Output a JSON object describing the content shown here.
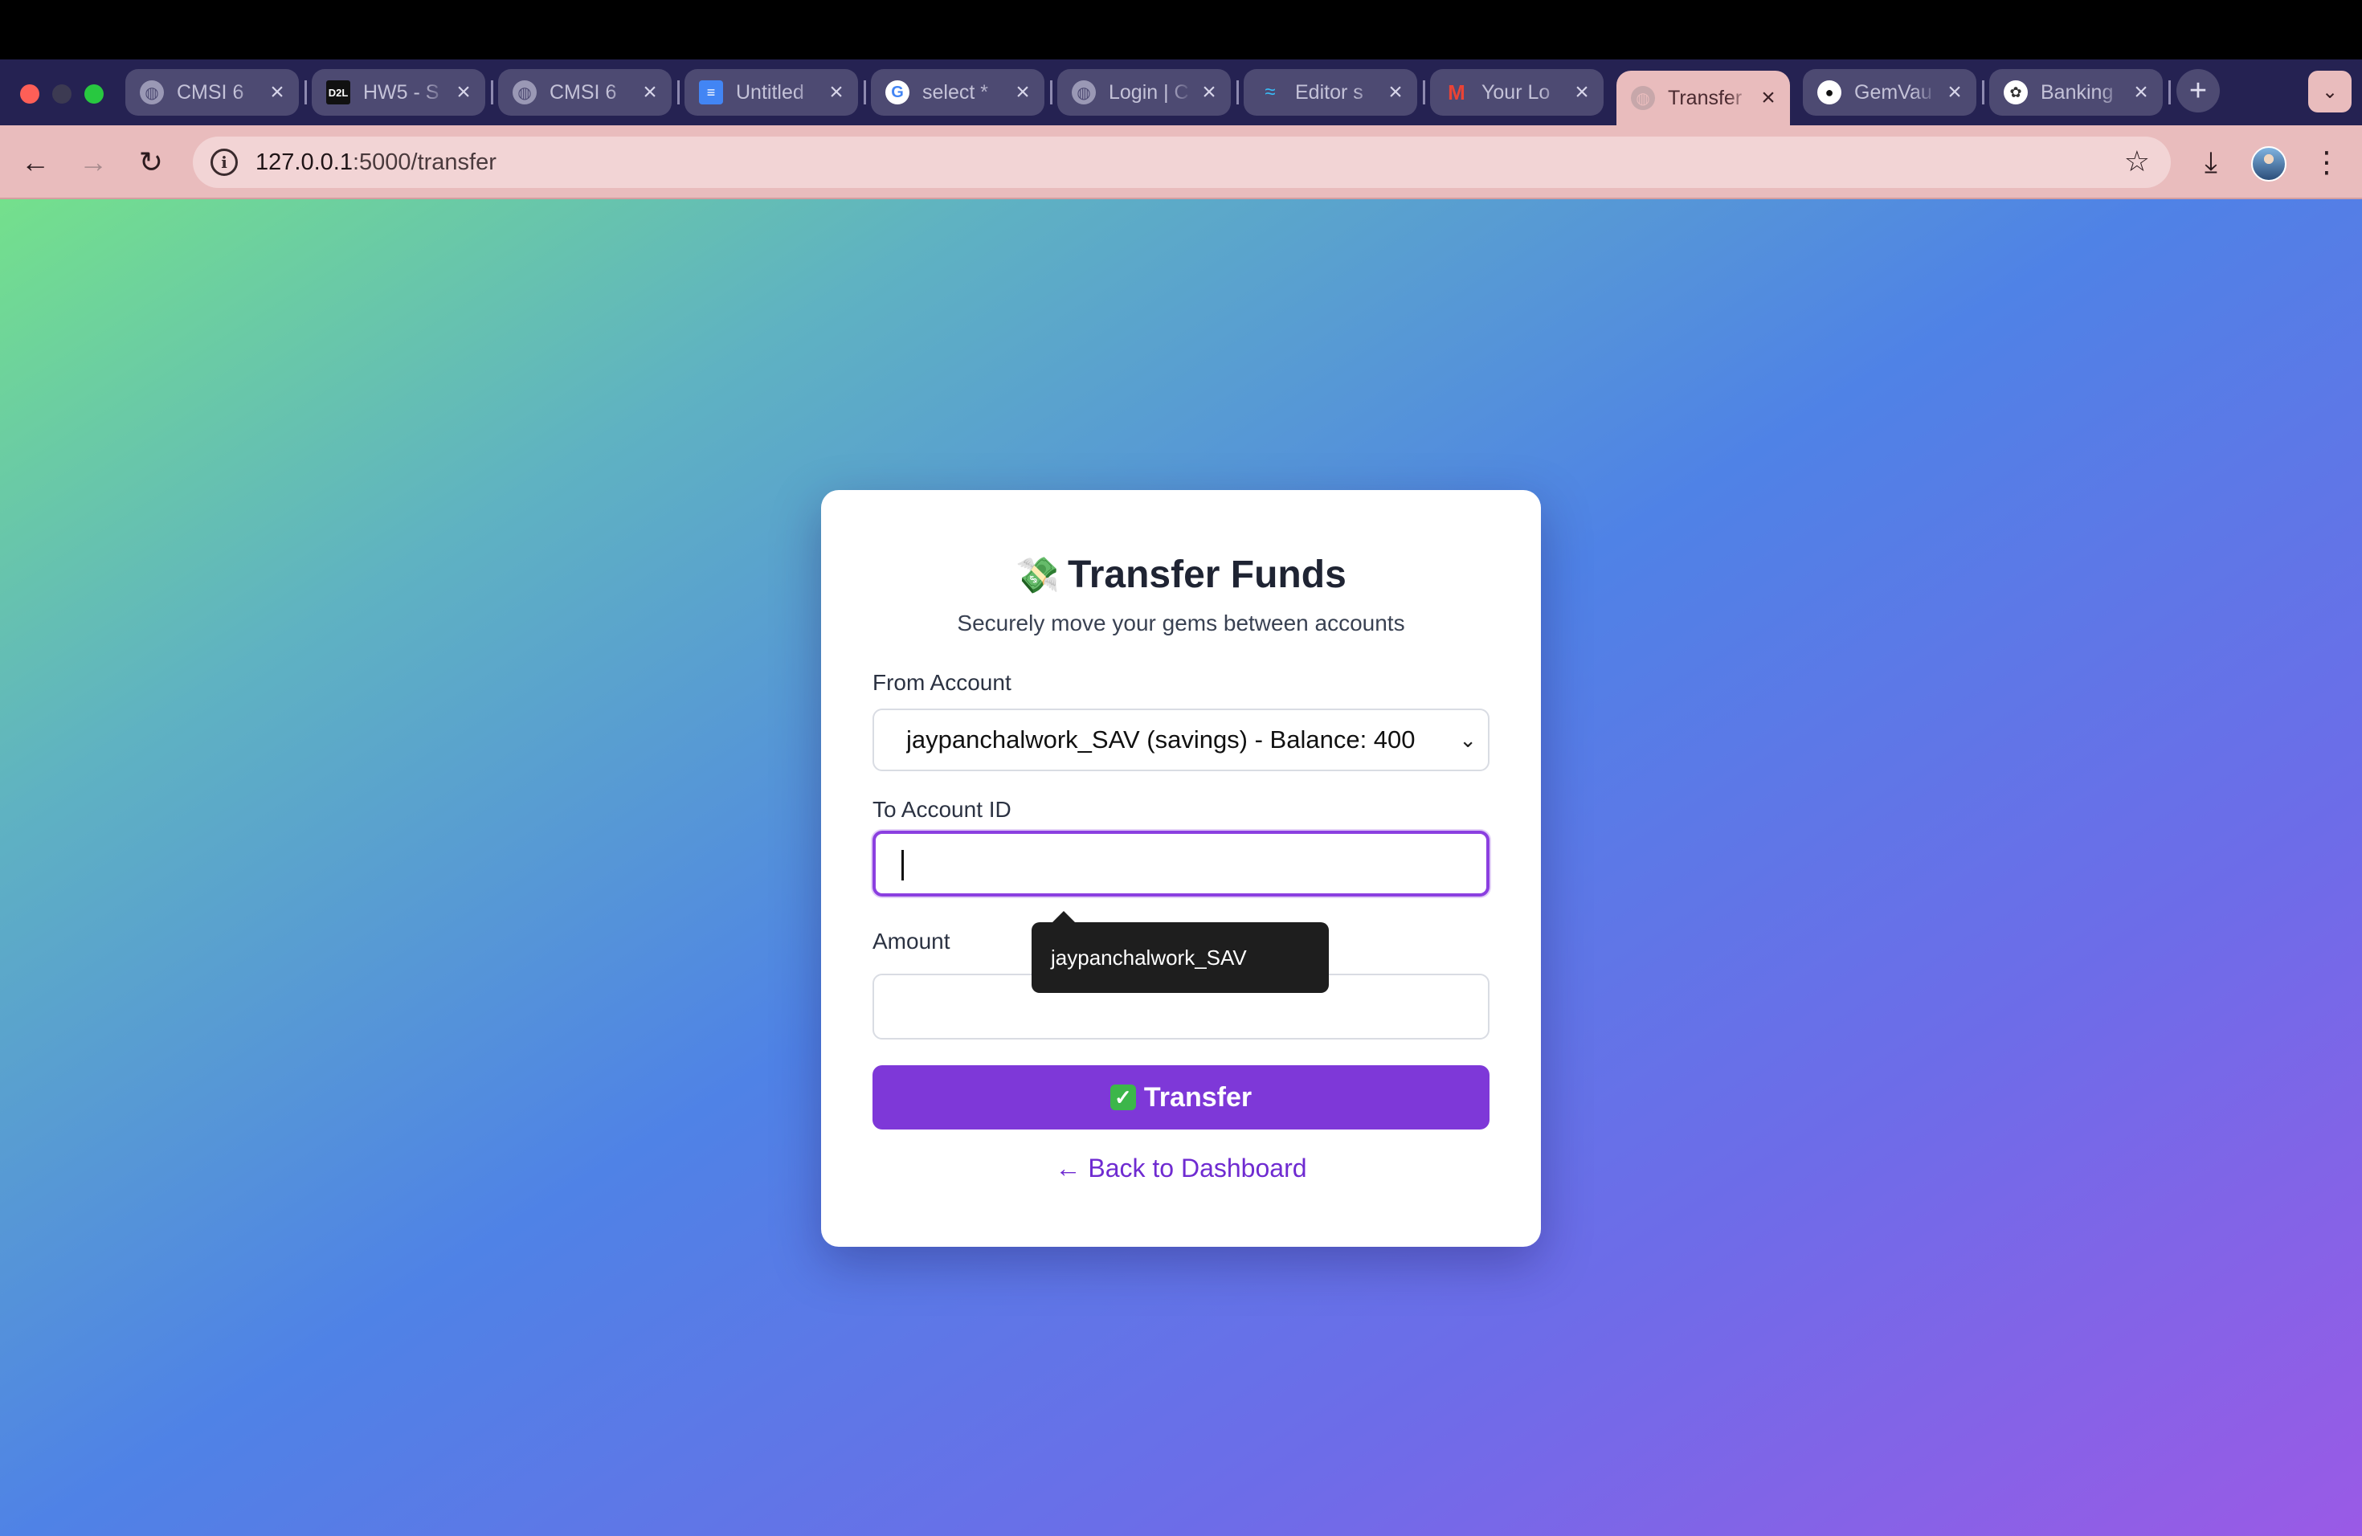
{
  "browser": {
    "tabs": [
      {
        "title": "CMSI 6",
        "favicon": "globe-icon"
      },
      {
        "title": "HW5 - S",
        "favicon": "d2l-icon"
      },
      {
        "title": "CMSI 6",
        "favicon": "globe-icon"
      },
      {
        "title": "Untitled",
        "favicon": "google-docs-icon"
      },
      {
        "title": "select *",
        "favicon": "google-icon"
      },
      {
        "title": "Login | C",
        "favicon": "globe-icon"
      },
      {
        "title": "Editor s",
        "favicon": "tailwind-icon"
      },
      {
        "title": "Your Lo",
        "favicon": "gmail-icon"
      },
      {
        "title": "Transfer",
        "favicon": "globe-icon",
        "active": true
      },
      {
        "title": "GemVau",
        "favicon": "github-icon"
      },
      {
        "title": "Banking",
        "favicon": "openai-icon"
      }
    ],
    "tab_close_glyph": "×",
    "new_tab_glyph": "+",
    "url_host": "127.0.0.1",
    "url_path": ":5000/transfer",
    "accent": "#e9bcbd"
  },
  "page": {
    "title_emoji": "💸",
    "title": "Transfer Funds",
    "subtitle": "Securely move your gems between accounts",
    "from_label": "From Account",
    "from_value": "jaypanchalwork_SAV (savings) - Balance: 400",
    "to_label": "To Account ID",
    "to_value": "",
    "autofill_suggestion": "jaypanchalwork_SAV",
    "amount_label": "Amount",
    "amount_value": "",
    "submit_emoji": "✓",
    "submit_label": "Transfer",
    "back_link": "← Back to Dashboard",
    "button_color": "#7e38d8",
    "focus_color": "#8b3fe0"
  }
}
